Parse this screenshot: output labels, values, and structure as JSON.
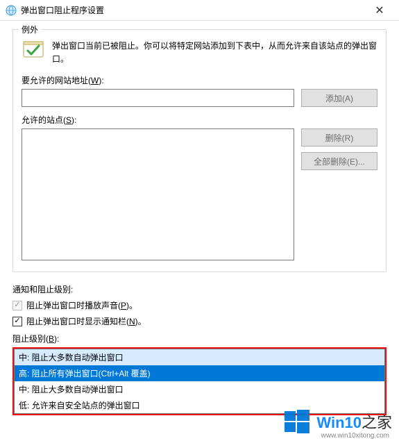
{
  "window": {
    "title": "弹出窗口阻止程序设置",
    "close_glyph": "✕"
  },
  "exceptions_group": {
    "legend": "例外",
    "description": "弹出窗口当前已被阻止。你可以将特定网站添加到下表中，从而允许来自该站点的弹出窗口。",
    "address_label_prefix": "要允许的网站地址(",
    "address_label_letter": "W",
    "address_label_suffix": "):",
    "address_value": "",
    "add_button": "添加(A)",
    "allowed_label_prefix": "允许的站点(",
    "allowed_label_letter": "S",
    "allowed_label_suffix": "):",
    "remove_button": "删除(R)",
    "remove_all_button": "全部删除(E)..."
  },
  "notify_group": {
    "legend": "通知和阻止级别:",
    "play_sound": {
      "label_prefix": "阻止弹出窗口时播放声音(",
      "label_letter": "P",
      "label_suffix": ")。",
      "checked": true,
      "enabled": false
    },
    "show_bar": {
      "label_prefix": "阻止弹出窗口时显示通知栏(",
      "label_letter": "N",
      "label_suffix": ")。",
      "checked": true,
      "enabled": true
    },
    "block_level_label_prefix": "阻止级别(",
    "block_level_label_letter": "B",
    "block_level_label_suffix": "):",
    "dropdown_items": [
      {
        "text": "中: 阻止大多数自动弹出窗口",
        "state": "hover"
      },
      {
        "text": "高: 阻止所有弹出窗口(Ctrl+Alt 覆盖)",
        "state": "selected"
      },
      {
        "text": "中: 阻止大多数自动弹出窗口",
        "state": "normal"
      },
      {
        "text": "低: 允许来自安全站点的弹出窗口",
        "state": "normal"
      }
    ]
  },
  "watermark": {
    "brand_main": "Win10",
    "brand_sub": "之家",
    "url": "www.win10xitong.com"
  }
}
